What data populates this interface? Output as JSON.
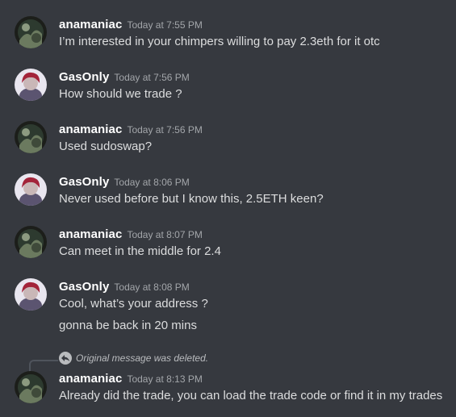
{
  "messages": [
    {
      "username": "anamaniac",
      "timestamp": "Today at 7:55 PM",
      "lines": [
        "I’m interested in your chimpers willing to pay 2.3eth for it otc"
      ]
    },
    {
      "username": "GasOnly",
      "timestamp": "Today at 7:56 PM",
      "lines": [
        "How should we trade ?"
      ]
    },
    {
      "username": "anamaniac",
      "timestamp": "Today at 7:56 PM",
      "lines": [
        "Used sudoswap?"
      ]
    },
    {
      "username": "GasOnly",
      "timestamp": "Today at 8:06 PM",
      "lines": [
        "Never used before but I know this, 2.5ETH keen?"
      ]
    },
    {
      "username": "anamaniac",
      "timestamp": "Today at 8:07 PM",
      "lines": [
        "Can meet in the middle for 2.4"
      ]
    },
    {
      "username": "GasOnly",
      "timestamp": "Today at 8:08 PM",
      "lines": [
        "Cool, what’s your address ?",
        "gonna be back in 20 mins"
      ]
    },
    {
      "username": "anamaniac",
      "timestamp": "Today at 8:13 PM",
      "reply_note": "Original message was deleted.",
      "lines": [
        "Already did the trade, you can load the trade code or find it in my trades"
      ]
    }
  ],
  "icons": {
    "reply": "reply-arrow-icon",
    "avatar_anamaniac": "dark-nature-avatar",
    "avatar_gasonly": "red-hair-character-avatar"
  },
  "colors": {
    "background": "#36393f",
    "username": "#ffffff",
    "text": "#dcddde",
    "timestamp": "#a3a6aa"
  }
}
